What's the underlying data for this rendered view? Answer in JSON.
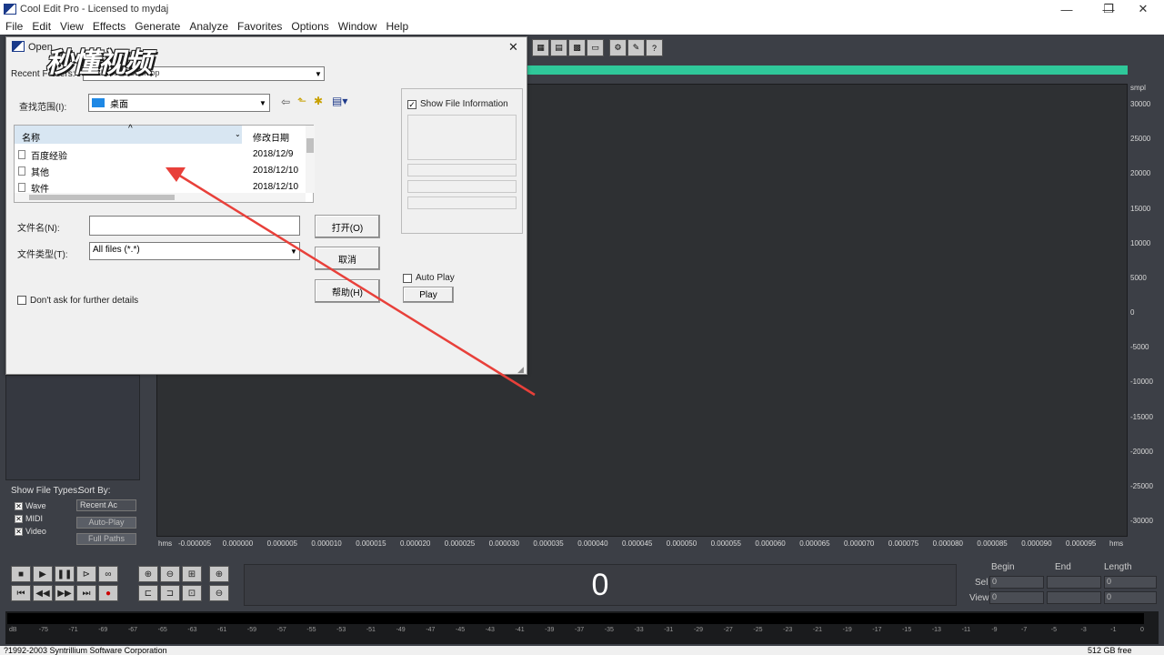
{
  "app": {
    "title": "Cool Edit Pro - Licensed to mydaj",
    "window_controls": {
      "minimize": "—",
      "maximize": "❐",
      "close": "✕"
    },
    "menu": [
      "File",
      "Edit",
      "View",
      "Effects",
      "Generate",
      "Analyze",
      "Favorites",
      "Options",
      "Window",
      "Help"
    ]
  },
  "watermark": "秒懂视频",
  "dialog": {
    "title": "Open",
    "close_glyph": "✕",
    "recent_label": "Recent Folders:",
    "recent_value": "C:\\Users\\...\\Desktop",
    "lookin_label": "查找范围(I):",
    "lookin_value": "桌面",
    "columns": {
      "name": "名称",
      "date": "修改日期"
    },
    "files": [
      {
        "name": "百度经验",
        "date": "2018/12/9"
      },
      {
        "name": "其他",
        "date": "2018/12/10"
      },
      {
        "name": "软件",
        "date": "2018/12/10"
      }
    ],
    "filename_label": "文件名(N):",
    "filename_value": "",
    "filetype_label": "文件类型(T):",
    "filetype_value": "All files (*.*)",
    "open_button": "打开(O)",
    "cancel_button": "取消",
    "help_button": "帮助(H)",
    "dont_ask_label": "Don't ask for further details",
    "show_info_label": "Show File Information",
    "auto_play_label": "Auto Play",
    "play_button": "Play"
  },
  "left_panel": {
    "show_types_label": "Show File Types:",
    "sort_by_label": "Sort By:",
    "types": [
      "Wave",
      "MIDI",
      "Video"
    ],
    "sort_value": "Recent Ac",
    "auto_play_button": "Auto-Play",
    "full_paths_button": "Full Paths"
  },
  "waveform": {
    "unit_label": "smpl",
    "y_ticks": [
      "30000",
      "25000",
      "20000",
      "15000",
      "10000",
      "5000",
      "0",
      "-5000",
      "-10000",
      "-15000",
      "-20000",
      "-25000",
      "-30000"
    ],
    "x_unit_left": "hms",
    "x_unit_right": "hms",
    "x_ticks": [
      "-0.000005",
      "0.000000",
      "0.000005",
      "0.000010",
      "0.000015",
      "0.000020",
      "0.000025",
      "0.000030",
      "0.000035",
      "0.000040",
      "0.000045",
      "0.000050",
      "0.000055",
      "0.000060",
      "0.000065",
      "0.000070",
      "0.000075",
      "0.000080",
      "0.000085",
      "0.000090",
      "0.000095"
    ]
  },
  "transport": {
    "time": "0",
    "begin_label": "Begin",
    "end_label": "End",
    "length_label": "Length",
    "sel_label": "Sel",
    "view_label": "View",
    "sel_begin": "0",
    "sel_length": "0",
    "view_begin": "0",
    "view_length": "0"
  },
  "meter_ticks": [
    "dB",
    "-75",
    "-71",
    "-69",
    "-67",
    "-65",
    "-63",
    "-61",
    "-59",
    "-57",
    "-55",
    "-53",
    "-51",
    "-49",
    "-47",
    "-45",
    "-43",
    "-41",
    "-39",
    "-37",
    "-35",
    "-33",
    "-31",
    "-29",
    "-27",
    "-25",
    "-23",
    "-21",
    "-19",
    "-17",
    "-15",
    "-13",
    "-11",
    "-9",
    "-7",
    "-5",
    "-3",
    "-1",
    "0"
  ],
  "status": {
    "copyright": "?1992-2003 Syntrillium Software Corporation",
    "disk_free": "512 GB free"
  },
  "colors": {
    "app_bg": "#3c3f46",
    "wave_strip": "#2fc89a",
    "annotation_arrow": "#e8403a"
  }
}
